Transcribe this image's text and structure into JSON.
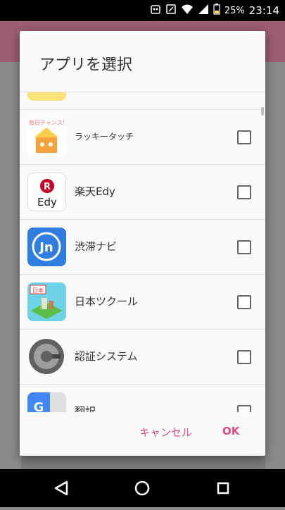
{
  "status_bar": {
    "battery_text": "25%",
    "time": "23:14",
    "icons": [
      "notification-icon",
      "nfc-icon",
      "wifi-icon",
      "signal-icon",
      "battery-icon"
    ]
  },
  "dialog": {
    "title": "アプリを選択",
    "items": [
      {
        "label": "",
        "icon": "sticky-note-icon"
      },
      {
        "label": "ラッキータッチ",
        "icon": "lucky-touch-icon",
        "badge": "毎日チャンス!"
      },
      {
        "label": "楽天Edy",
        "icon": "rakuten-edy-icon",
        "icon_text_top": "R",
        "icon_text_bottom": "Edy"
      },
      {
        "label": "渋滞ナビ",
        "icon": "traffic-navi-icon",
        "icon_text": "Jn"
      },
      {
        "label": "日本ツクール",
        "icon": "nihon-tsukuru-icon",
        "icon_text": "日本"
      },
      {
        "label": "認証システム",
        "icon": "authenticator-icon"
      },
      {
        "label": "翻訳",
        "icon": "translate-icon",
        "icon_text": "G"
      }
    ],
    "buttons": {
      "cancel": "キャンセル",
      "ok": "OK"
    }
  },
  "colors": {
    "accent": "#e04a86",
    "background_app_bar": "#9b5d73",
    "dialog_bg": "#fafafa"
  },
  "nav_bar": {
    "icons": [
      "back-icon",
      "home-icon",
      "recents-icon"
    ]
  }
}
